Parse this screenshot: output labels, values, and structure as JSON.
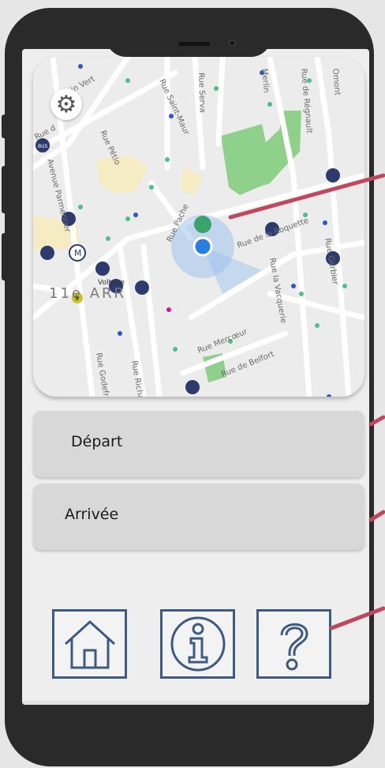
{
  "map": {
    "settings_icon": "gear-icon",
    "labels": {
      "rue_vert": "in Vert",
      "rue_de": "Rue d",
      "avenue": "Avenue Parmentier",
      "rue_saint_maur": "Rue Saint-Maur",
      "rue_servan": "Rue Serva",
      "rue_pache": "Rue Pache",
      "rue_roquette": "Rue de la Roquette",
      "rue_vacquerie": "Rue la Vacquerie",
      "rue_gerbier": "Rue Gerbier",
      "rue_mercoeur": "Rue Mercœur",
      "rue_belfort": "Rue de Belfort",
      "rue_godefroy": "Rue Godefr",
      "rue_richard": "Rue Richa",
      "rue_petion": "Rue Pétio",
      "rue_merlin": "Merlin",
      "rue_regnault": "Rue de Régnault",
      "rue_omont": "Omont",
      "voltaire": "Voltaire",
      "arrondissement": "11e ARR",
      "metro_badge": "M",
      "metro_line": "9",
      "bus_badge": "BUS"
    }
  },
  "fields": {
    "depart": "Départ",
    "arrivee": "Arrivée"
  },
  "buttons": {
    "home_icon": "home-icon",
    "info_icon": "info-icon",
    "help_icon": "help-icon"
  },
  "colors": {
    "frame": "#2a2a2a",
    "accent_border": "#3e5a80",
    "pointer_line": "#c0485e",
    "location": "#2a7de1",
    "park": "#8fd08a"
  }
}
